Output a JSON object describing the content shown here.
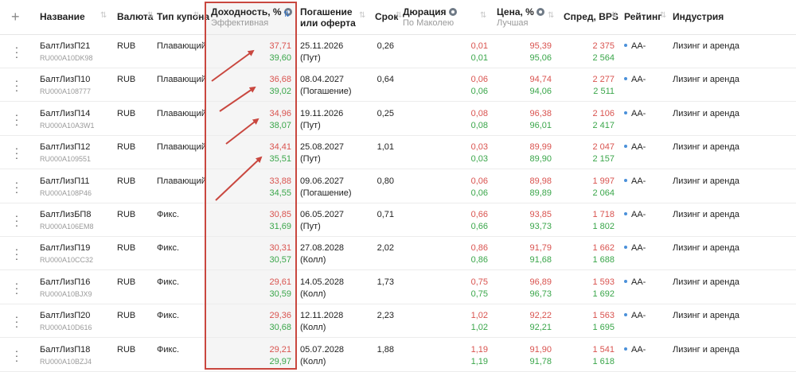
{
  "columns": {
    "add": "+",
    "name": "Название",
    "currency": "Валюта",
    "coupon_type": "Тип купона",
    "yield": "Доходность, %",
    "yield_sub": "Эффективная",
    "maturity_line1": "Погашение",
    "maturity_line2": "или оферта",
    "term": "Срок",
    "duration": "Дюрация",
    "duration_sub": "По Маколею",
    "price": "Цена, %",
    "price_sub": "Лучшая",
    "spread": "Спред, BPS",
    "rating": "Рейтинг",
    "industry": "Индустрия",
    "sort_glyph": "⇅"
  },
  "rows": [
    {
      "name": "БалтЛизП21",
      "isin": "RU000A10DK98",
      "currency": "RUB",
      "coupon": "Плавающий",
      "yield_1": "37,71",
      "yield_2": "39,60",
      "maturity": "25.11.2026",
      "offer": "(Пут)",
      "term": "0,26",
      "dur_1": "0,01",
      "dur_2": "0,01",
      "price_1": "95,39",
      "price_2": "95,06",
      "spread_1": "2 375",
      "spread_2": "2 564",
      "rating": "AA-",
      "industry": "Лизинг и аренда"
    },
    {
      "name": "БалтЛизП10",
      "isin": "RU000A108777",
      "currency": "RUB",
      "coupon": "Плавающий",
      "yield_1": "36,68",
      "yield_2": "39,02",
      "maturity": "08.04.2027",
      "offer": "(Погашение)",
      "term": "0,64",
      "dur_1": "0,06",
      "dur_2": "0,06",
      "price_1": "94,74",
      "price_2": "94,06",
      "spread_1": "2 277",
      "spread_2": "2 511",
      "rating": "AA-",
      "industry": "Лизинг и аренда"
    },
    {
      "name": "БалтЛизП14",
      "isin": "RU000A10A3W1",
      "currency": "RUB",
      "coupon": "Плавающий",
      "yield_1": "34,96",
      "yield_2": "38,07",
      "maturity": "19.11.2026",
      "offer": "(Пут)",
      "term": "0,25",
      "dur_1": "0,08",
      "dur_2": "0,08",
      "price_1": "96,38",
      "price_2": "96,01",
      "spread_1": "2 106",
      "spread_2": "2 417",
      "rating": "AA-",
      "industry": "Лизинг и аренда"
    },
    {
      "name": "БалтЛизП12",
      "isin": "RU000A109551",
      "currency": "RUB",
      "coupon": "Плавающий",
      "yield_1": "34,41",
      "yield_2": "35,51",
      "maturity": "25.08.2027",
      "offer": "(Пут)",
      "term": "1,01",
      "dur_1": "0,03",
      "dur_2": "0,03",
      "price_1": "89,99",
      "price_2": "89,90",
      "spread_1": "2 047",
      "spread_2": "2 157",
      "rating": "AA-",
      "industry": "Лизинг и аренда"
    },
    {
      "name": "БалтЛизП11",
      "isin": "RU000A108P46",
      "currency": "RUB",
      "coupon": "Плавающий",
      "yield_1": "33,88",
      "yield_2": "34,55",
      "maturity": "09.06.2027",
      "offer": "(Погашение)",
      "term": "0,80",
      "dur_1": "0,06",
      "dur_2": "0,06",
      "price_1": "89,98",
      "price_2": "89,89",
      "spread_1": "1 997",
      "spread_2": "2 064",
      "rating": "AA-",
      "industry": "Лизинг и аренда"
    },
    {
      "name": "БалтЛизБП8",
      "isin": "RU000A106EM8",
      "currency": "RUB",
      "coupon": "Фикс.",
      "yield_1": "30,85",
      "yield_2": "31,69",
      "maturity": "06.05.2027",
      "offer": "(Пут)",
      "term": "0,71",
      "dur_1": "0,66",
      "dur_2": "0,66",
      "price_1": "93,85",
      "price_2": "93,73",
      "spread_1": "1 718",
      "spread_2": "1 802",
      "rating": "AA-",
      "industry": "Лизинг и аренда"
    },
    {
      "name": "БалтЛизП19",
      "isin": "RU000A10CC32",
      "currency": "RUB",
      "coupon": "Фикс.",
      "yield_1": "30,31",
      "yield_2": "30,57",
      "maturity": "27.08.2028",
      "offer": "(Колл)",
      "term": "2,02",
      "dur_1": "0,86",
      "dur_2": "0,86",
      "price_1": "91,79",
      "price_2": "91,68",
      "spread_1": "1 662",
      "spread_2": "1 688",
      "rating": "AA-",
      "industry": "Лизинг и аренда"
    },
    {
      "name": "БалтЛизП16",
      "isin": "RU000A10BJX9",
      "currency": "RUB",
      "coupon": "Фикс.",
      "yield_1": "29,61",
      "yield_2": "30,59",
      "maturity": "14.05.2028",
      "offer": "(Колл)",
      "term": "1,73",
      "dur_1": "0,75",
      "dur_2": "0,75",
      "price_1": "96,89",
      "price_2": "96,73",
      "spread_1": "1 593",
      "spread_2": "1 692",
      "rating": "AA-",
      "industry": "Лизинг и аренда"
    },
    {
      "name": "БалтЛизП20",
      "isin": "RU000A10D616",
      "currency": "RUB",
      "coupon": "Фикс.",
      "yield_1": "29,36",
      "yield_2": "30,68",
      "maturity": "12.11.2028",
      "offer": "(Колл)",
      "term": "2,23",
      "dur_1": "1,02",
      "dur_2": "1,02",
      "price_1": "92,22",
      "price_2": "92,21",
      "spread_1": "1 563",
      "spread_2": "1 695",
      "rating": "AA-",
      "industry": "Лизинг и аренда"
    },
    {
      "name": "БалтЛизП18",
      "isin": "RU000A10BZJ4",
      "currency": "RUB",
      "coupon": "Фикс.",
      "yield_1": "29,21",
      "yield_2": "29,97",
      "maturity": "05.07.2028",
      "offer": "(Колл)",
      "term": "1,88",
      "dur_1": "1,19",
      "dur_2": "1,19",
      "price_1": "91,90",
      "price_2": "91,78",
      "spread_1": "1 541",
      "spread_2": "1 618",
      "rating": "AA-",
      "industry": "Лизинг и аренда"
    }
  ],
  "colors": {
    "bid_red": "#d9534f",
    "ask_green": "#3aa64a",
    "highlight_border": "#c9473f",
    "rating_dot": "#4a90d9"
  }
}
